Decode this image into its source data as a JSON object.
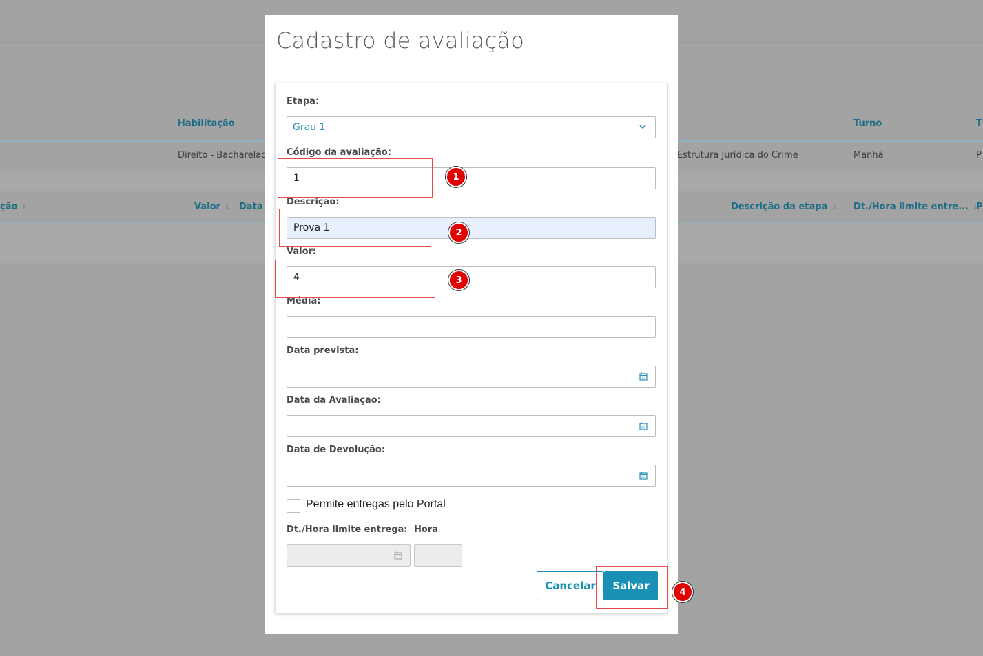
{
  "background": {
    "row1_headers": {
      "habilitacao": "Habilitação",
      "turno": "Turno",
      "t": "T"
    },
    "row1_cells": {
      "habilitacao": "Direito - Bacharelado",
      "disciplina": "Estrutura Jurídica do Crime",
      "turno": "Manhã",
      "p": "P"
    },
    "row2_headers": {
      "cao": "ção",
      "valor": "Valor",
      "data": "Data p",
      "descricao_etapa": "Descrição da etapa",
      "dt_hora": "Dt./Hora limite entre...",
      "p": "P"
    }
  },
  "modal": {
    "title": "Cadastro de avaliação",
    "etapa": {
      "label": "Etapa:",
      "value": "Grau 1"
    },
    "codigo": {
      "label": "Código da avaliação:",
      "value": "1"
    },
    "descricao": {
      "label": "Descrição:",
      "value": "Prova 1"
    },
    "valor": {
      "label": "Valor:",
      "value": "4"
    },
    "media": {
      "label": "Média:",
      "value": ""
    },
    "data_prevista": {
      "label": "Data prevista:",
      "value": ""
    },
    "data_avaliacao": {
      "label": "Data da Avaliação:",
      "value": ""
    },
    "data_devolucao": {
      "label": "Data de Devolução:",
      "value": ""
    },
    "portal": {
      "label": "Permite entregas pelo Portal",
      "checked": false
    },
    "dt_limite": {
      "label": "Dt./Hora limite entrega:",
      "value": ""
    },
    "hora": {
      "label": "Hora",
      "value": ""
    },
    "buttons": {
      "cancel": "Cancelar",
      "save": "Salvar"
    }
  },
  "annotations": [
    "1",
    "2",
    "3",
    "4"
  ],
  "colors": {
    "accent": "#1a91b4",
    "annotation": "#e00000"
  }
}
